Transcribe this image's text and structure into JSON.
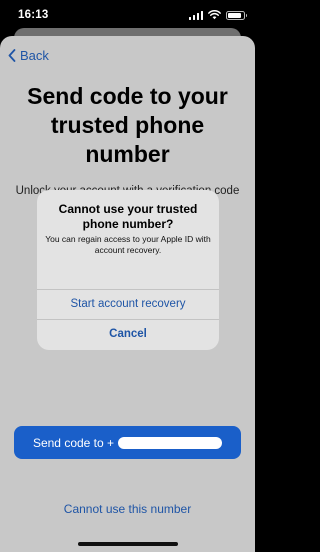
{
  "status_bar": {
    "time": "16:13"
  },
  "nav": {
    "back_label": "Back"
  },
  "page": {
    "title": "Send code to your trusted phone number",
    "subtitle": "Unlock your account with a verification code sent to your trusted phone number."
  },
  "actions": {
    "send_code_label": "Send code to +",
    "cannot_use_label": "Cannot use this number"
  },
  "alert": {
    "title": "Cannot use your trusted phone number?",
    "message": "You can regain access to your Apple ID with account recovery.",
    "primary_label": "Start account recovery",
    "cancel_label": "Cancel"
  },
  "colors": {
    "accent": "#1a5fc9",
    "link": "#1f55a6",
    "sheet_dimmed": "#c8c8c8",
    "alert_bg": "#e3e3e3"
  },
  "icons": {
    "back": "chevron-left-icon",
    "signal": "cellular-signal-icon",
    "wifi": "wifi-icon",
    "battery": "battery-icon"
  }
}
